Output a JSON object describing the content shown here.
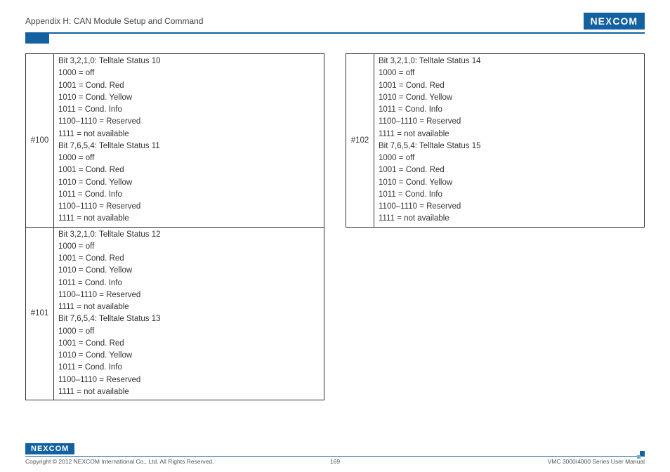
{
  "header": {
    "title": "Appendix H: CAN Module Setup and Command",
    "logo_text": "NE COM",
    "logo_x": "X"
  },
  "tables": {
    "left": [
      {
        "id": "#100",
        "lines": [
          "Bit 3,2,1,0: Telltale Status 10",
          "1000 = off",
          "1001 = Cond. Red",
          "1010 = Cond. Yellow",
          "1011 = Cond. Info",
          "1100–1110 = Reserved",
          "1111 = not available",
          "Bit 7,6,5,4: Telltale Status 11",
          "1000 = off",
          "1001 = Cond. Red",
          "1010 = Cond. Yellow",
          "1011 = Cond. Info",
          "1100–1110 = Reserved",
          "1111 = not available"
        ]
      },
      {
        "id": "#101",
        "lines": [
          "Bit 3,2,1,0: Telltale Status 12",
          "1000 = off",
          "1001 = Cond. Red",
          "1010 = Cond. Yellow",
          "1011 = Cond. Info",
          "1100–1110 = Reserved",
          "1111 = not available",
          "Bit 7,6,5,4: Telltale Status 13",
          "1000 = off",
          "1001 = Cond. Red",
          "1010 = Cond. Yellow",
          "1011 = Cond. Info",
          "1100–1110 = Reserved",
          "1111 = not available"
        ]
      }
    ],
    "right": [
      {
        "id": "#102",
        "lines": [
          "Bit 3,2,1,0: Telltale Status 14",
          "1000 = off",
          "1001 = Cond. Red",
          "1010 = Cond. Yellow",
          "1011 = Cond. Info",
          "1100–1110 = Reserved",
          "1111 = not available",
          "Bit 7,6,5,4: Telltale Status 15",
          "1000 = off",
          "1001 = Cond. Red",
          "1010 = Cond. Yellow",
          "1011 = Cond. Info",
          "1100–1110 = Reserved",
          "1111 = not available"
        ]
      }
    ]
  },
  "footer": {
    "logo_text": "NE COM",
    "logo_x": "X",
    "copyright": "Copyright © 2012 NEXCOM International Co., Ltd. All Rights Reserved.",
    "page_number": "169",
    "manual": "VMC 3000/4000 Series User Manual"
  }
}
